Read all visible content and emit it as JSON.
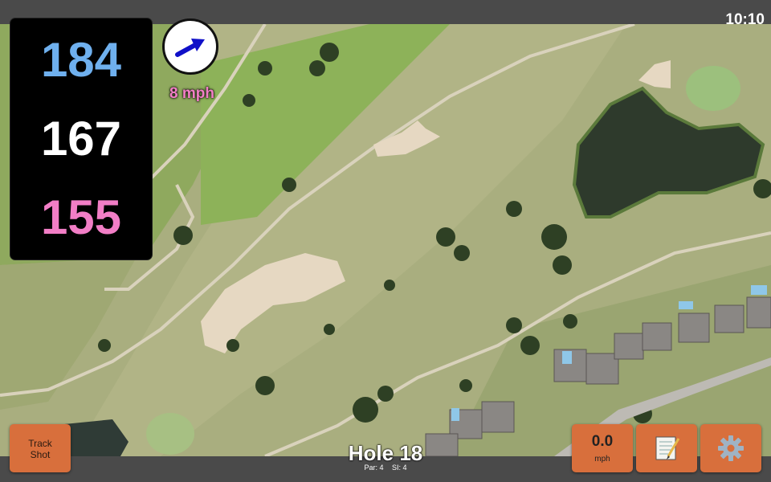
{
  "status": {
    "time": "10:10"
  },
  "distances": {
    "back": "184",
    "middle": "167",
    "front": "155"
  },
  "wind": {
    "speed": "8 mph",
    "direction_icon": "arrow-right-icon"
  },
  "buttons": {
    "track_shot": "Track Shot",
    "speed_value": "0.0",
    "speed_unit": "mph",
    "notes_icon": "notepad-icon",
    "settings_icon": "gear-icon"
  },
  "hole": {
    "title": "Hole 18",
    "par": "Par: 4",
    "si": "SI: 4"
  },
  "colors": {
    "back_distance": "#6fb0ee",
    "middle_distance": "#ffffff",
    "front_distance": "#f27ec6",
    "button_orange": "#d86f3c"
  }
}
